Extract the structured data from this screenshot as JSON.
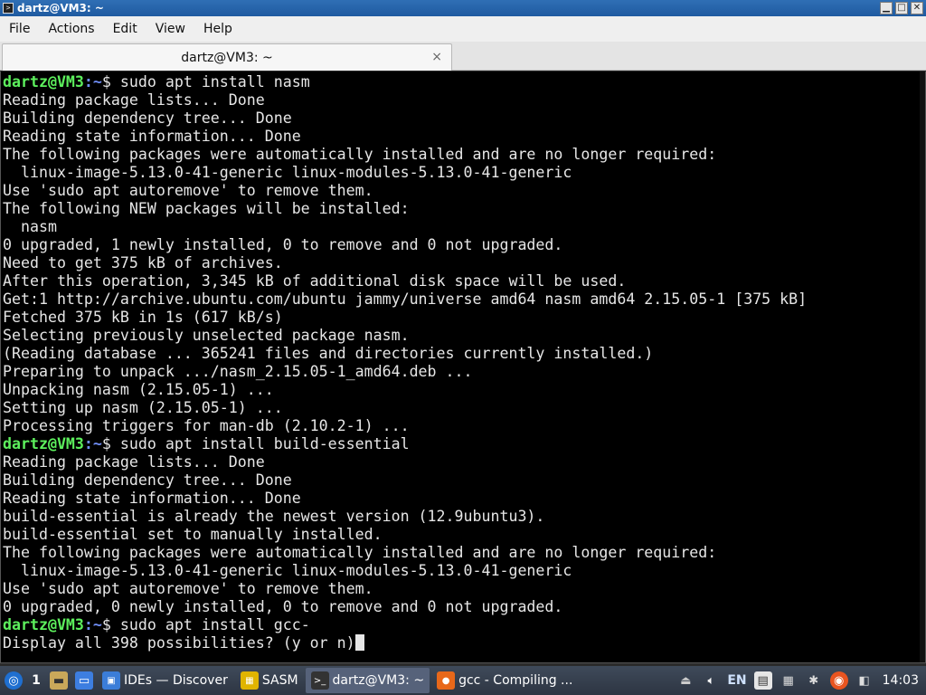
{
  "window": {
    "title": "dartz@VM3: ~",
    "controls": [
      "▁",
      "□",
      "✕"
    ]
  },
  "menu": [
    "File",
    "Actions",
    "Edit",
    "View",
    "Help"
  ],
  "tab": {
    "label": "dartz@VM3: ~",
    "close": "×"
  },
  "terminal": {
    "lines": [
      {
        "type": "prompt",
        "user": "dartz@VM3",
        "sep": ":",
        "path": "~",
        "sym": "$ ",
        "cmd": "sudo apt install nasm"
      },
      {
        "type": "out",
        "text": "Reading package lists... Done"
      },
      {
        "type": "out",
        "text": "Building dependency tree... Done"
      },
      {
        "type": "out",
        "text": "Reading state information... Done"
      },
      {
        "type": "out",
        "text": "The following packages were automatically installed and are no longer required:"
      },
      {
        "type": "out",
        "text": "  linux-image-5.13.0-41-generic linux-modules-5.13.0-41-generic"
      },
      {
        "type": "out",
        "text": "Use 'sudo apt autoremove' to remove them."
      },
      {
        "type": "out",
        "text": "The following NEW packages will be installed:"
      },
      {
        "type": "out",
        "text": "  nasm"
      },
      {
        "type": "out",
        "text": "0 upgraded, 1 newly installed, 0 to remove and 0 not upgraded."
      },
      {
        "type": "out",
        "text": "Need to get 375 kB of archives."
      },
      {
        "type": "out",
        "text": "After this operation, 3,345 kB of additional disk space will be used."
      },
      {
        "type": "out",
        "text": "Get:1 http://archive.ubuntu.com/ubuntu jammy/universe amd64 nasm amd64 2.15.05-1 [375 kB]"
      },
      {
        "type": "out",
        "text": "Fetched 375 kB in 1s (617 kB/s)"
      },
      {
        "type": "out",
        "text": "Selecting previously unselected package nasm."
      },
      {
        "type": "out",
        "text": "(Reading database ... 365241 files and directories currently installed.)"
      },
      {
        "type": "out",
        "text": "Preparing to unpack .../nasm_2.15.05-1_amd64.deb ..."
      },
      {
        "type": "out",
        "text": "Unpacking nasm (2.15.05-1) ..."
      },
      {
        "type": "out",
        "text": "Setting up nasm (2.15.05-1) ..."
      },
      {
        "type": "out",
        "text": "Processing triggers for man-db (2.10.2-1) ..."
      },
      {
        "type": "prompt",
        "user": "dartz@VM3",
        "sep": ":",
        "path": "~",
        "sym": "$ ",
        "cmd": "sudo apt install build-essential"
      },
      {
        "type": "out",
        "text": "Reading package lists... Done"
      },
      {
        "type": "out",
        "text": "Building dependency tree... Done"
      },
      {
        "type": "out",
        "text": "Reading state information... Done"
      },
      {
        "type": "out",
        "text": "build-essential is already the newest version (12.9ubuntu3)."
      },
      {
        "type": "out",
        "text": "build-essential set to manually installed."
      },
      {
        "type": "out",
        "text": "The following packages were automatically installed and are no longer required:"
      },
      {
        "type": "out",
        "text": "  linux-image-5.13.0-41-generic linux-modules-5.13.0-41-generic"
      },
      {
        "type": "out",
        "text": "Use 'sudo apt autoremove' to remove them."
      },
      {
        "type": "out",
        "text": "0 upgraded, 0 newly installed, 0 to remove and 0 not upgraded."
      },
      {
        "type": "prompt",
        "user": "dartz@VM3",
        "sep": ":",
        "path": "~",
        "sym": "$ ",
        "cmd": "sudo apt install gcc-"
      },
      {
        "type": "out",
        "text": "Display all 398 possibilities? (y or n)",
        "cursor": true
      }
    ]
  },
  "taskbar": {
    "desktop_number": "1",
    "tasks": [
      {
        "label": "IDEs — Discover",
        "icon": "discover-icon",
        "glyph": "▣",
        "color": "#3b7dd8"
      },
      {
        "label": "SASM",
        "icon": "sasm-icon",
        "glyph": "▦",
        "color": "#e0b400"
      },
      {
        "label": "dartz@VM3: ~",
        "icon": "terminal-icon",
        "glyph": ">_",
        "color": "#333333",
        "active": true
      },
      {
        "label": "gcc - Compiling ...",
        "icon": "firefox-icon",
        "glyph": "●",
        "color": "#e8681a"
      }
    ],
    "lang": "EN",
    "clock": "14:03"
  }
}
